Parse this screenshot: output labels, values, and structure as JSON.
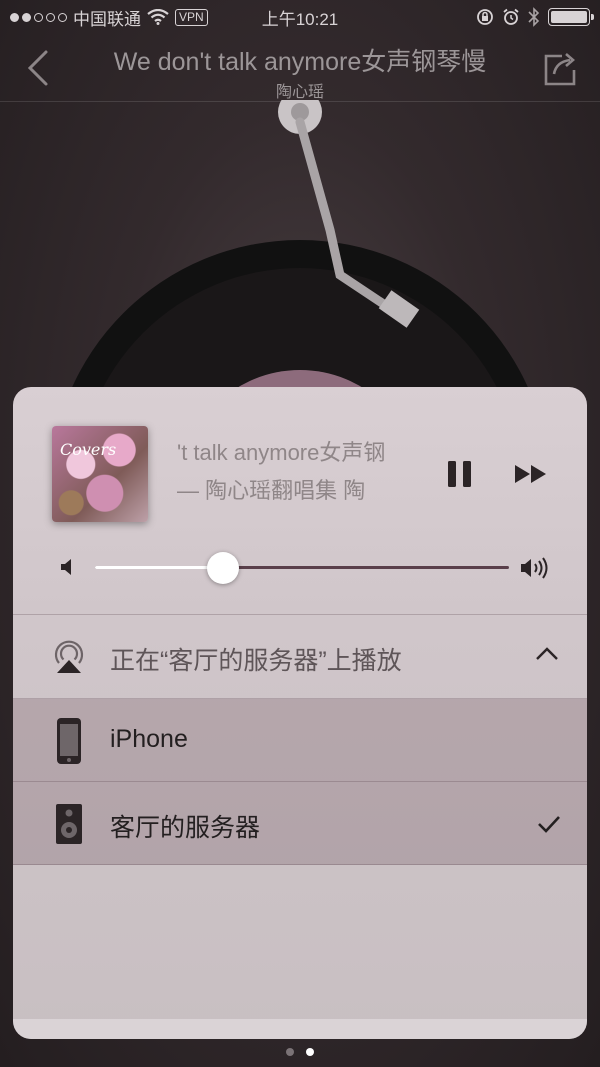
{
  "status_bar": {
    "carrier": "中国联通",
    "vpn": "VPN",
    "time": "上午10:21"
  },
  "nav": {
    "title": "We don't talk anymore女声钢琴慢",
    "subtitle": "陶心瑶"
  },
  "now_playing": {
    "album_art_text": "Covers",
    "title": "'t talk anymore女声钢",
    "subtitle": "—  陶心瑶翻唱集    陶",
    "volume_fraction": 0.31
  },
  "route": {
    "header": "正在“客厅的服务器”上播放",
    "devices": [
      {
        "label": "iPhone",
        "icon": "iphone-icon",
        "selected": false
      },
      {
        "label": "客厅的服务器",
        "icon": "speaker-icon",
        "selected": true
      }
    ]
  },
  "pager": {
    "pages": 2,
    "active_index": 1
  },
  "colors": {
    "panel": "#d3c9cd",
    "selected_row": "#a99a9f",
    "text_dark": "#231f20",
    "text_muted": "#8f8688"
  }
}
